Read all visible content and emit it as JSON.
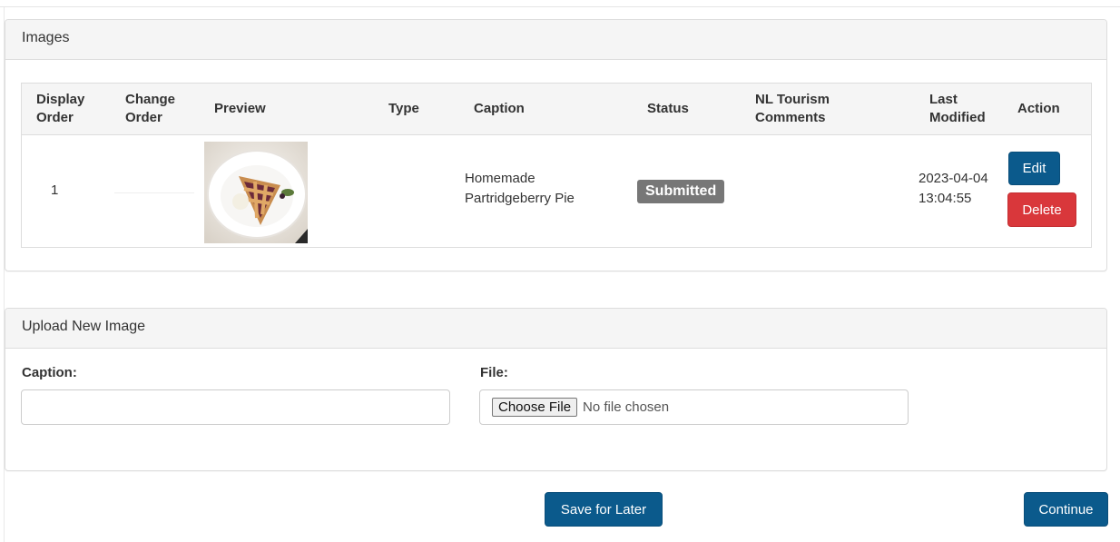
{
  "images_panel": {
    "title": "Images",
    "columns": [
      "Display Order",
      "Change Order",
      "Preview",
      "Type",
      "Caption",
      "Status",
      "NL Tourism Comments",
      "Last Modified",
      "Action"
    ],
    "rows": [
      {
        "display_order": "1",
        "type": "",
        "caption": "Homemade Partridgeberry Pie",
        "status": "Submitted",
        "comments": "",
        "last_modified_date": "2023-04-04",
        "last_modified_time": "13:04:55",
        "edit_label": "Edit",
        "delete_label": "Delete"
      }
    ]
  },
  "upload_panel": {
    "title": "Upload New Image",
    "caption_label": "Caption:",
    "caption_value": "",
    "file_label": "File:",
    "choose_file_label": "Choose File",
    "no_file_text": "No file chosen"
  },
  "footer": {
    "save_later_label": "Save for Later",
    "continue_label": "Continue"
  },
  "colors": {
    "primary": "#0b5a8c",
    "danger": "#d9373b",
    "status_badge": "#777777"
  }
}
